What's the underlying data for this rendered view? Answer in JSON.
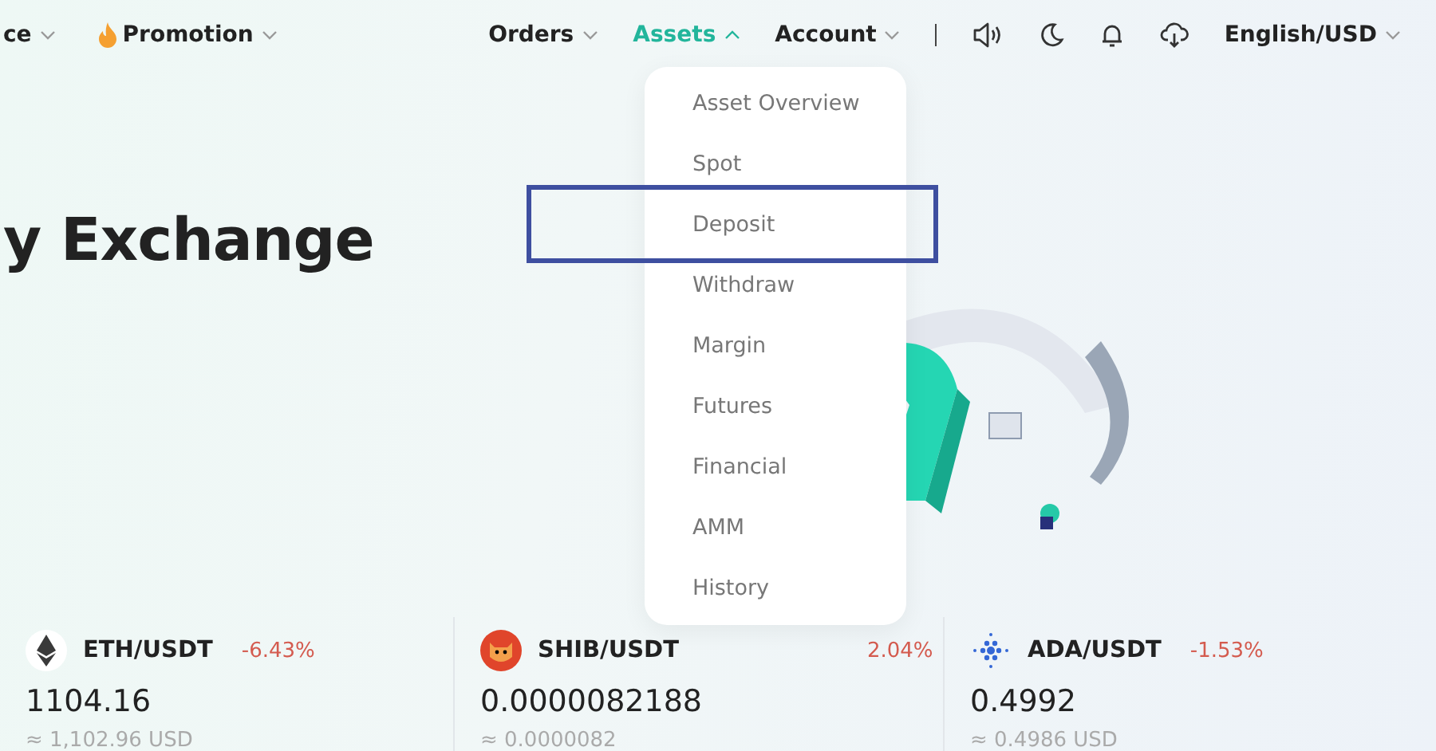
{
  "nav": {
    "left": [
      {
        "label": "ce"
      },
      {
        "label": "Promotion"
      }
    ],
    "right": [
      {
        "label": "Orders",
        "selected": false,
        "expanded": false
      },
      {
        "label": "Assets",
        "selected": true,
        "expanded": true
      },
      {
        "label": "Account",
        "selected": false,
        "expanded": false
      }
    ],
    "language": "English/USD"
  },
  "hero": {
    "title": "y Exchange"
  },
  "assets_menu": {
    "items": [
      {
        "label": "Asset Overview",
        "highlighted": false
      },
      {
        "label": "Spot",
        "highlighted": false
      },
      {
        "label": "Deposit",
        "highlighted": true
      },
      {
        "label": "Withdraw",
        "highlighted": false
      },
      {
        "label": "Margin",
        "highlighted": false
      },
      {
        "label": "Futures",
        "highlighted": false
      },
      {
        "label": "Financial",
        "highlighted": false
      },
      {
        "label": "AMM",
        "highlighted": false
      },
      {
        "label": "History",
        "highlighted": false
      }
    ]
  },
  "tickers": [
    {
      "pair": "ETH/USDT",
      "change": "-6.43%",
      "price": "1104.16",
      "usd": "≈ 1,102.96 USD"
    },
    {
      "pair": "SHIB/USDT",
      "change": "2.04%",
      "price": "0.0000082188",
      "usd": "≈ 0.0000082"
    },
    {
      "pair": "ADA/USDT",
      "change": "-1.53%",
      "price": "0.4992",
      "usd": "≈ 0.4986 USD"
    }
  ]
}
